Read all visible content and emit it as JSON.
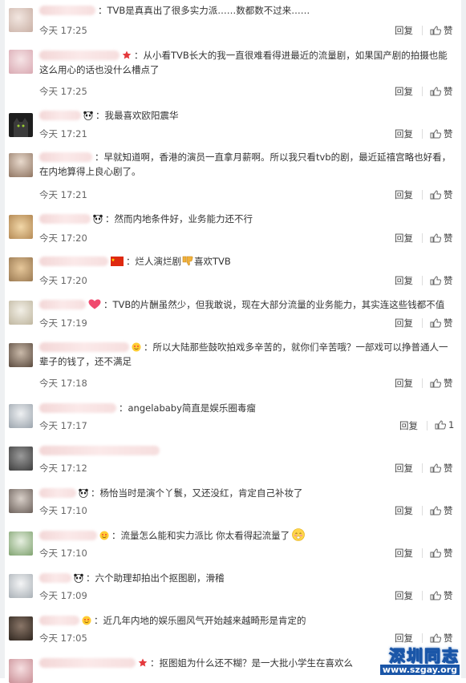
{
  "comments": [
    {
      "text": "TVB是真真出了很多实力派……数都数不过来……",
      "time": "今天 17:25",
      "reply": "回复",
      "like": "赞",
      "badge": "none",
      "avatar": "#d9c6bd"
    },
    {
      "text": "从小看TVB长大的我一直很难看得进最近的流量剧，如果国产剧的拍摄也能这么用心的话也没什么槽点了",
      "time": "今天 17:25",
      "reply": "回复",
      "like": "赞",
      "badge": "star",
      "avatar": "#e9d0d4"
    },
    {
      "text": "我最喜欢欧阳震华",
      "time": "今天 17:21",
      "reply": "回复",
      "like": "赞",
      "badge": "panda",
      "avatar": "#2a2a2a"
    },
    {
      "text": "早就知道啊，香港的演员一直拿月薪啊。所以我只看tvb的剧，最近延禧宫略也好看，在内地算得上良心剧了。",
      "time": "今天 17:21",
      "reply": "回复",
      "like": "赞",
      "badge": "none",
      "avatar": "#b8a38f"
    },
    {
      "text": "然而内地条件好，业务能力还不行",
      "time": "今天 17:20",
      "reply": "回复",
      "like": "赞",
      "badge": "panda",
      "avatar": "#c9a56d"
    },
    {
      "text": "烂人演烂剧",
      "text2": "喜欢TVB",
      "time": "今天 17:20",
      "reply": "回复",
      "like": "赞",
      "badge": "flag",
      "avatar": "#c8a87a"
    },
    {
      "text": "TVB的片酬虽然少，但我敢说，现在大部分流量的业务能力，其实连这些钱都不值",
      "time": "今天 17:19",
      "reply": "回复",
      "like": "赞",
      "badge": "heart",
      "avatar": "#cfc9b8"
    },
    {
      "text": "所以大陆那些鼓吹拍戏多辛苦的，就你们辛苦哦？一部戏可以挣普通人一辈子的钱了，还不满足",
      "time": "今天 17:18",
      "reply": "回复",
      "like": "赞",
      "badge": "emoji",
      "avatar": "#8c7a6a"
    },
    {
      "text": "angelababy简直是娱乐圈毒瘤",
      "time": "今天 17:17",
      "reply": "回复",
      "like": "1",
      "badge": "none",
      "avatar": "#d7d9dc"
    },
    {
      "text": "",
      "time": "今天 17:12",
      "reply": "回复",
      "like": "赞",
      "badge": "none",
      "avatar": "#6f6f6f"
    },
    {
      "text": "杨怡当时是演个丫鬟，又还没红，肯定自己补妆了",
      "time": "今天 17:10",
      "reply": "回复",
      "like": "赞",
      "badge": "panda",
      "avatar": "#9a8f88"
    },
    {
      "text": "流量怎么能和实力派比 你太看得起流量了",
      "time": "今天 17:10",
      "reply": "回复",
      "like": "赞",
      "badge": "emoji",
      "avatar": "#aecb9f"
    },
    {
      "text": "六个助理却拍出个抠图剧，滑稽",
      "time": "今天 17:09",
      "reply": "回复",
      "like": "赞",
      "badge": "panda",
      "avatar": "#c4c8cc"
    },
    {
      "text": "近几年内地的娱乐圈风气开始越来越畸形是肯定的",
      "time": "今天 17:05",
      "reply": "回复",
      "like": "赞",
      "badge": "emoji",
      "avatar": "#5a4a3c"
    },
    {
      "text": "抠图姐为什么还不糊？是一大批小学生在喜欢么",
      "time": "",
      "reply": "",
      "like": "",
      "badge": "star",
      "avatar": "#e3b7ba"
    }
  ],
  "watermark": {
    "title": "深圳同志",
    "url": "www.szgay.org",
    "color": "#1a56a8"
  }
}
